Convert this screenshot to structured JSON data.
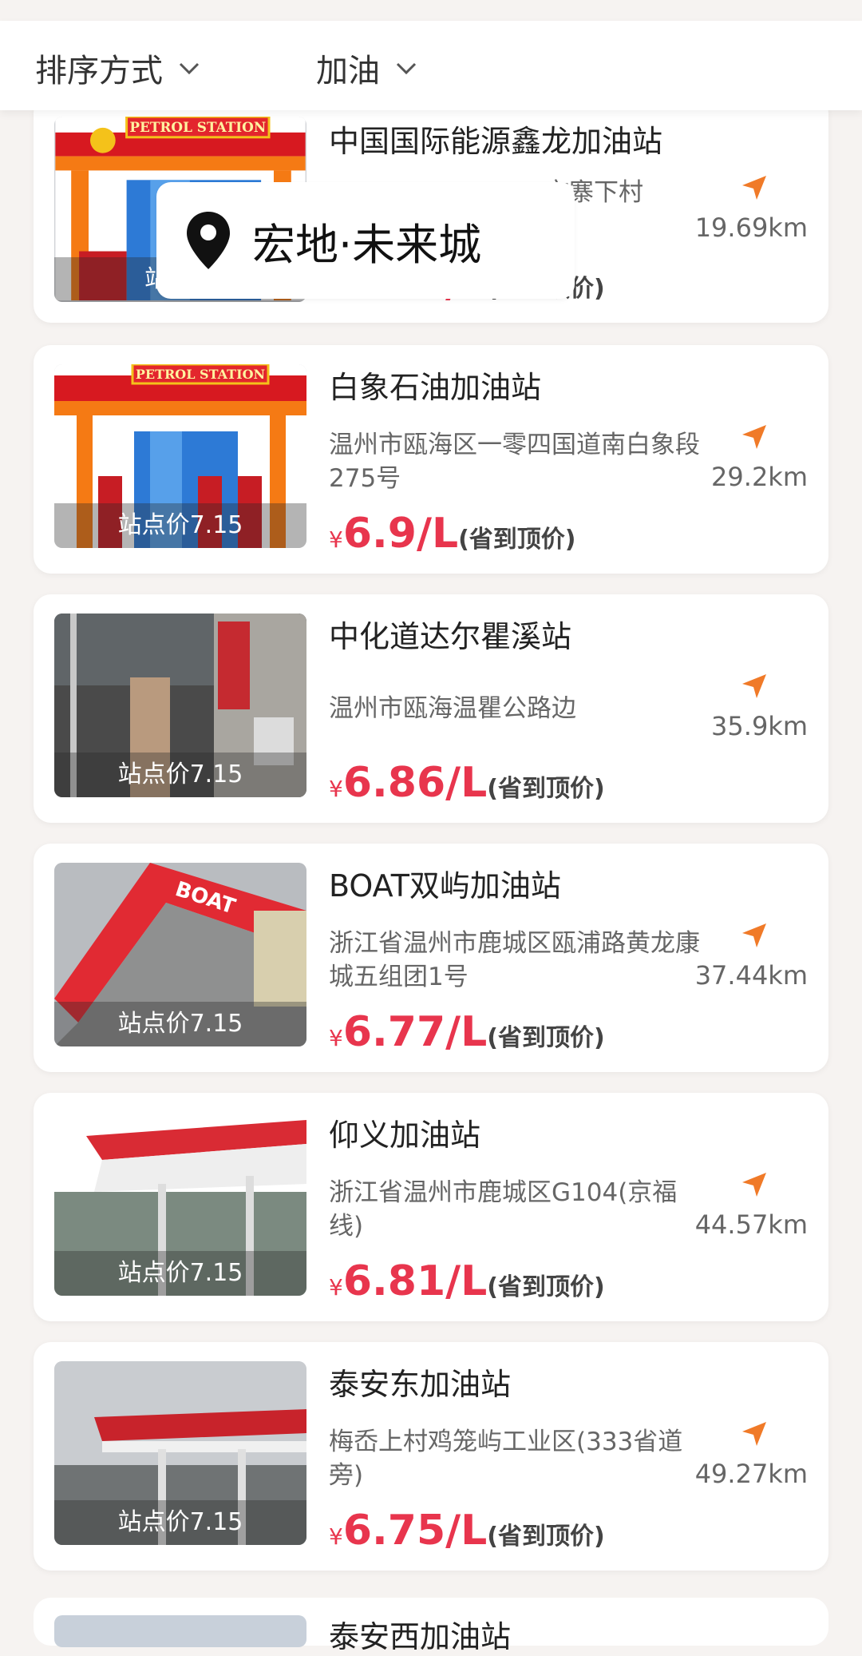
{
  "filters": [
    {
      "label": "排序方式"
    },
    {
      "label": "加油"
    }
  ],
  "location_popup": {
    "text": "宏地·未来城"
  },
  "accent_color": "#e8354d",
  "nav_icon_color": "#f07a28",
  "stations": [
    {
      "name": "中国国际能源鑫龙加油站",
      "address": "市寨下村",
      "distance": "19.69km",
      "station_price": "站点价",
      "yen": "¥",
      "price": "6.93/L",
      "note": "(省到顶价)",
      "thumb": "petrol-illustration-1"
    },
    {
      "name": "白象石油加油站",
      "address": "温州市瓯海区一零四国道南白象段275号",
      "distance": "29.2km",
      "station_price": "站点价7.15",
      "yen": "¥",
      "price": "6.9/L",
      "note": "(省到顶价)",
      "thumb": "petrol-illustration-2"
    },
    {
      "name": "中化道达尔瞿溪站",
      "address": "温州市瓯海温瞿公路边",
      "distance": "35.9km",
      "station_price": "站点价7.15",
      "yen": "¥",
      "price": "6.86/L",
      "note": "(省到顶价)",
      "thumb": "photo-station-1"
    },
    {
      "name": "BOAT双屿加油站",
      "address": "浙江省温州市鹿城区瓯浦路黄龙康城五组团1号",
      "distance": "37.44km",
      "station_price": "站点价7.15",
      "yen": "¥",
      "price": "6.77/L",
      "note": "(省到顶价)",
      "thumb": "photo-boat"
    },
    {
      "name": "仰义加油站",
      "address": "浙江省温州市鹿城区G104(京福线)",
      "distance": "44.57km",
      "station_price": "站点价7.15",
      "yen": "¥",
      "price": "6.81/L",
      "note": "(省到顶价)",
      "thumb": "photo-canopy-1"
    },
    {
      "name": "泰安东加油站",
      "address": "梅岙上村鸡笼屿工业区(333省道旁)",
      "distance": "49.27km",
      "station_price": "站点价7.15",
      "yen": "¥",
      "price": "6.75/L",
      "note": "(省到顶价)",
      "thumb": "photo-canopy-2"
    }
  ],
  "next_station_peek": {
    "name": "泰安西加油站"
  }
}
